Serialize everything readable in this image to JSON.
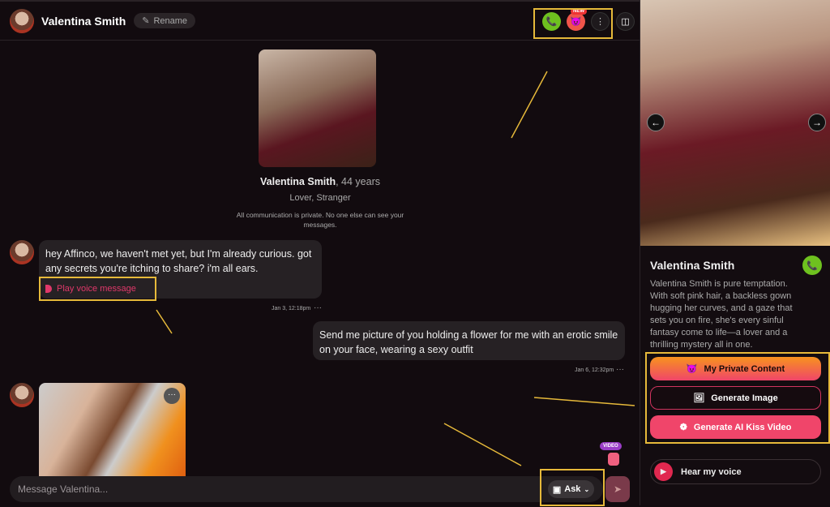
{
  "header": {
    "name": "Valentina Smith",
    "rename_label": "Rename",
    "new_badge": "NEW"
  },
  "profile": {
    "name": "Valentina Smith",
    "age": ", 44 years",
    "tags": "Lover, Stranger",
    "privacy": "All communication is private. No one else can see your messages."
  },
  "messages": [
    {
      "sender": "Valentina Smith",
      "text": "hey Affinco, we haven't met yet, but I'm already curious. got any secrets you're itching to share? i'm all ears.",
      "voice_label": "Play voice message",
      "timestamp": "Jan 3, 12:18pm"
    },
    {
      "sender": "user",
      "text": "Send me picture of you holding a flower for me with an erotic smile on your face, wearing a sexy outfit",
      "timestamp": "Jan 6, 12:32pm"
    }
  ],
  "composer": {
    "placeholder": "Message Valentina...",
    "mode_label": "Ask",
    "video_badge": "VIDEO"
  },
  "sidebar": {
    "name": "Valentina Smith",
    "description": "Valentina Smith is pure temptation. With soft pink hair, a backless gown hugging her curves, and a gaze that sets you on fire, she's every sinful fantasy come to life—a lover and a thrilling mystery all in one.",
    "buttons": [
      {
        "label": "My Private Content"
      },
      {
        "label": "Generate Image"
      },
      {
        "label": "Generate AI Kiss Video"
      }
    ],
    "voice_label": "Hear my voice"
  },
  "colors": {
    "accent": "#f0456a",
    "call": "#6ec11f",
    "annotation": "#e6b93a",
    "orange": "#f7931e"
  }
}
